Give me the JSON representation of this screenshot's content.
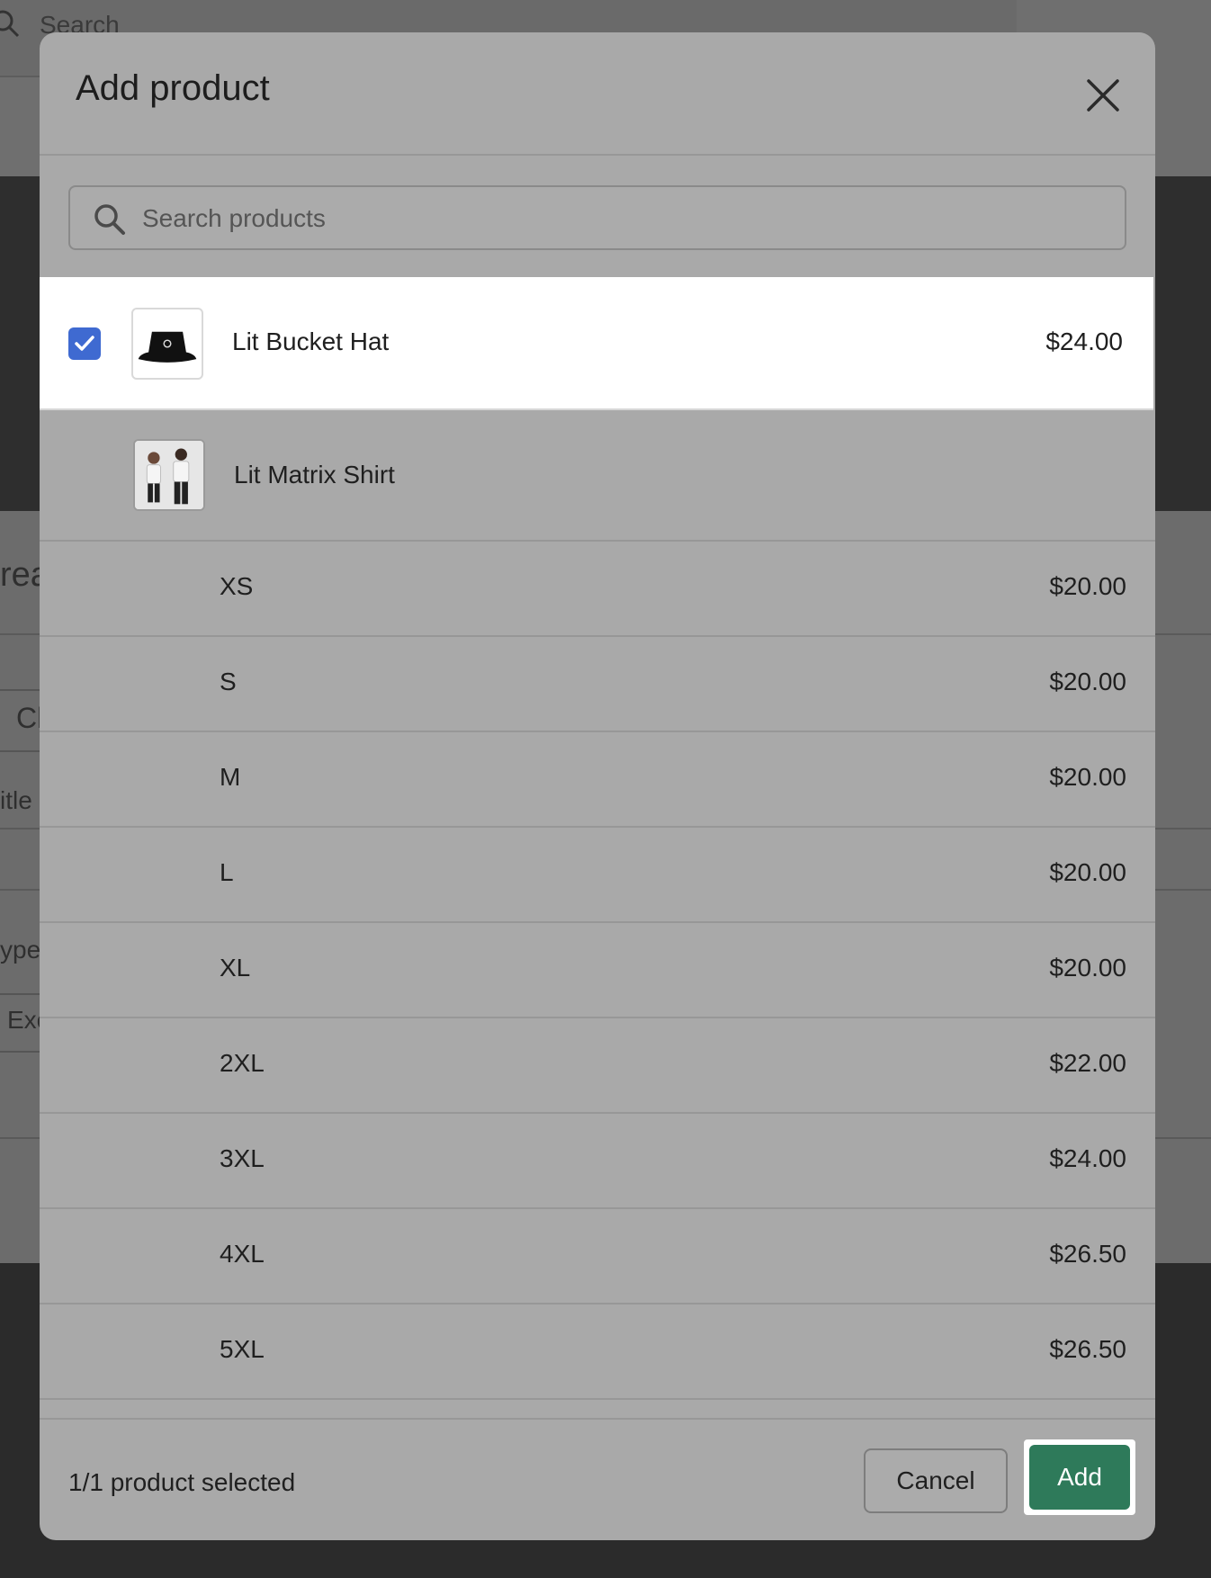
{
  "background": {
    "search_label": "Search",
    "fragments": {
      "heading": "rea",
      "field_a": "Cl",
      "label_title": "itle",
      "label_type": "ype",
      "field_b": "Exc"
    }
  },
  "modal": {
    "title": "Add product",
    "close_icon": "close-icon",
    "search": {
      "placeholder": "Search products",
      "value": "",
      "icon": "search-icon"
    },
    "selected_product": {
      "name": "Lit Bucket Hat",
      "price": "$24.00",
      "checked": true,
      "thumbnail": "bucket-hat-image"
    },
    "product": {
      "name": "Lit Matrix Shirt",
      "thumbnail": "shirt-models-image",
      "variants": [
        {
          "size": "XS",
          "price": "$20.00"
        },
        {
          "size": "S",
          "price": "$20.00"
        },
        {
          "size": "M",
          "price": "$20.00"
        },
        {
          "size": "L",
          "price": "$20.00"
        },
        {
          "size": "XL",
          "price": "$20.00"
        },
        {
          "size": "2XL",
          "price": "$22.00"
        },
        {
          "size": "3XL",
          "price": "$24.00"
        },
        {
          "size": "4XL",
          "price": "$26.50"
        },
        {
          "size": "5XL",
          "price": "$26.50"
        }
      ]
    },
    "footer": {
      "status": "1/1 product selected",
      "cancel_label": "Cancel",
      "add_label": "Add"
    }
  },
  "colors": {
    "overlay_modal": "#a9a9a9",
    "checkbox": "#3f6ad1",
    "primary_button": "#2e7a5a"
  }
}
